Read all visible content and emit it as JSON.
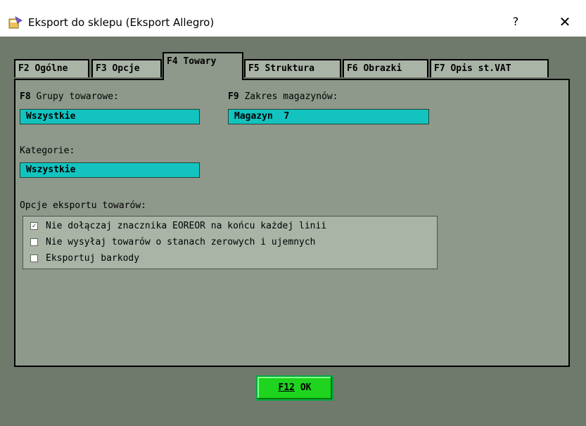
{
  "window": {
    "title": "Eksport do sklepu (Eksport Allegro)",
    "help_label": "?",
    "close_label": "✕"
  },
  "tabs": [
    {
      "key": "F2",
      "label": "Ogólne"
    },
    {
      "key": "F3",
      "label": "Opcje"
    },
    {
      "key": "F4",
      "label": "Towary",
      "active": true
    },
    {
      "key": "F5",
      "label": "Struktura"
    },
    {
      "key": "F6",
      "label": "Obrazki"
    },
    {
      "key": "F7",
      "label": "Opis st.VAT"
    }
  ],
  "groups": {
    "key": "F8",
    "label": "Grupy towarowe:",
    "value": "Wszystkie"
  },
  "warehouses": {
    "key": "F9",
    "label": "Zakres magazynów:",
    "value": "Magazyn  7"
  },
  "categories": {
    "label": "Kategorie:",
    "value": "Wszystkie"
  },
  "export_options": {
    "label": "Opcje eksportu towarów:",
    "items": [
      {
        "label": "Nie dołączaj znacznika EOREOR na końcu każdej linii",
        "checked": true
      },
      {
        "label": "Nie wysyłaj towarów o stanach zerowych i ujemnych",
        "checked": false
      },
      {
        "label": "Eksportuj barkody",
        "checked": false
      }
    ]
  },
  "ok_button": {
    "key": "F12",
    "label": "OK"
  },
  "colors": {
    "background": "#6f7a6c",
    "panel": "#8e998b",
    "field": "#12c3c0",
    "ok_button": "#1ed41e"
  }
}
